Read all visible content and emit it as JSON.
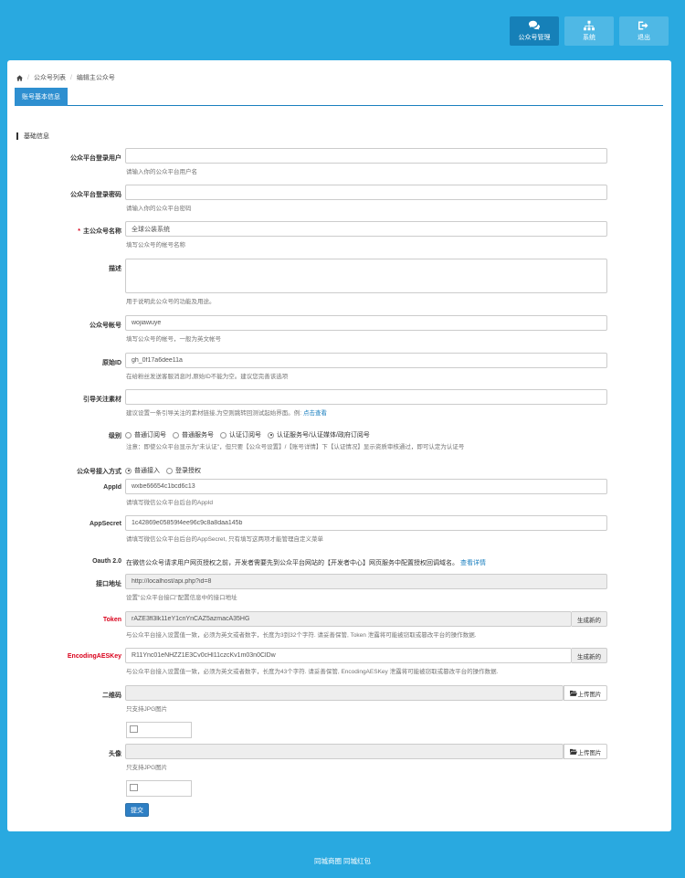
{
  "nav": {
    "items": [
      {
        "label": "公众号管理",
        "icon": "comments-icon",
        "active": true
      },
      {
        "label": "系统",
        "icon": "sitemap-icon",
        "active": false
      },
      {
        "label": "退出",
        "icon": "sign-out-icon",
        "active": false
      }
    ]
  },
  "breadcrumb": {
    "home_icon": "home-icon",
    "items": [
      "公众号列表",
      "编辑主公众号"
    ]
  },
  "tab": {
    "label": "账号基本信息"
  },
  "section": {
    "title": "基础信息"
  },
  "form": {
    "username": {
      "label": "公众平台登录用户",
      "value": "",
      "help": "请输入你的公众平台用户名"
    },
    "password": {
      "label": "公众平台登录密码",
      "value": "",
      "help": "请输入你的公众平台密码"
    },
    "name": {
      "label": "主公众号名称",
      "required_mark": "*",
      "value": "全球公装系统",
      "help": "填写公众号的帐号名称"
    },
    "description": {
      "label": "描述",
      "value": "",
      "help": "用于说明此公众号的功能及用途。"
    },
    "account": {
      "label": "公众号帐号",
      "value": "wojiawuye",
      "help": "填写公众号的帐号，一般为英文帐号"
    },
    "original_id": {
      "label": "原始ID",
      "value": "gh_0f17a6dee11a",
      "help": "在给粉丝发送客服消息时,原始ID不能为空。建议您完善该选项"
    },
    "guide": {
      "label": "引导关注素材",
      "value": "",
      "help": "建议设置一条引导关注的素材链接,为空则跳转回测试起始界面。例:",
      "help_link": "点击查看"
    },
    "level": {
      "label": "级别",
      "options": [
        "普通订阅号",
        "普通服务号",
        "认证订阅号",
        "认证服务号/认证媒体/政府订阅号"
      ],
      "selected": 3,
      "help": "注意：即使公众平台显示为\"未认证\"，但只要【公众号设置】/【账号详情】下【认证情况】显示资质审核通过，即可认定为认证号"
    },
    "access": {
      "label": "公众号接入方式",
      "options": [
        "普通接入",
        "登录授权"
      ],
      "selected": 0
    },
    "appid": {
      "label": "AppId",
      "value": "wxbe66654c1bcd6c13",
      "help": "请填写微信公众平台后台的AppId"
    },
    "appsecret": {
      "label": "AppSecret",
      "value": "1c42869e05859f4ee96c9c8a8daa145b",
      "help": "请填写微信公众平台后台的AppSecret, 只有填写这两项才能管理自定义菜单"
    },
    "oauth": {
      "label": "Oauth 2.0",
      "text": "在微信公众号请求用户网页授权之前，开发者需要先到公众平台网站的【开发者中心】网页服务中配置授权回调域名。",
      "link": "查看详情"
    },
    "api_url": {
      "label": "接口地址",
      "value": "http://localhost/api.php?id=8",
      "help": "设置\"公众平台接口\"配置信息中的接口地址"
    },
    "token": {
      "label": "Token",
      "value": "rAZE3fl3lk11eY1cnYnCAZ5azmacA35HG",
      "button": "生成新的",
      "help": "与公众平台接入设置值一致，必须为英文或者数字，长度为3到32个字符. 请妥善保管, Token 泄露将可能被窃取或篡改平台的操作数据."
    },
    "aeskey": {
      "label": "EncodingAESKey",
      "value": "R11Ync01eNHZZ1E3Cv0cHl11czcKv1m03n0ClDw",
      "button": "生成新的",
      "help": "与公众平台接入设置值一致，必须为英文或者数字，长度为43个字符. 请妥善保管, EncodingAESKey 泄露将可能被窃取或篡改平台的操作数据."
    },
    "qrcode": {
      "label": "二维码",
      "button": "上传图片",
      "help": "只支持JPG图片"
    },
    "avatar": {
      "label": "头像",
      "button": "上传图片",
      "help": "只支持JPG图片"
    },
    "submit": "提交"
  },
  "footer": {
    "text": "同城商圈  同城红包"
  }
}
